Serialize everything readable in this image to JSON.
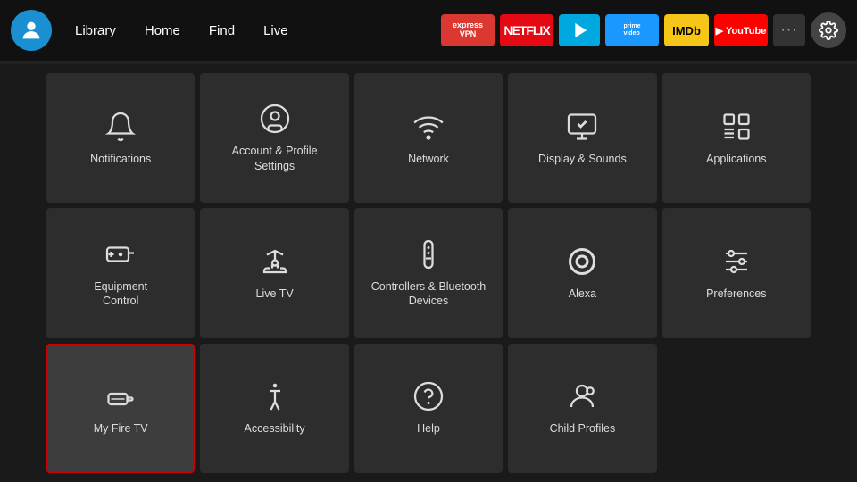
{
  "nav": {
    "links": [
      "Library",
      "Home",
      "Find",
      "Live"
    ],
    "apps": [
      {
        "name": "ExpressVPN",
        "label": "ExpressVPN"
      },
      {
        "name": "Netflix",
        "label": "NETFLIX"
      },
      {
        "name": "Freevee",
        "label": "▶"
      },
      {
        "name": "Prime Video",
        "label": "prime\nvideo"
      },
      {
        "name": "IMDb TV",
        "label": "IMDb"
      },
      {
        "name": "YouTube",
        "label": "▶ YouTube"
      }
    ]
  },
  "grid": {
    "items": [
      {
        "id": "notifications",
        "label": "Notifications",
        "icon": "bell"
      },
      {
        "id": "account-profile",
        "label": "Account & Profile\nSettings",
        "icon": "person-circle"
      },
      {
        "id": "network",
        "label": "Network",
        "icon": "wifi"
      },
      {
        "id": "display-sounds",
        "label": "Display & Sounds",
        "icon": "display-sound"
      },
      {
        "id": "applications",
        "label": "Applications",
        "icon": "apps"
      },
      {
        "id": "equipment-control",
        "label": "Equipment\nControl",
        "icon": "tv-remote"
      },
      {
        "id": "live-tv",
        "label": "Live TV",
        "icon": "antenna"
      },
      {
        "id": "controllers-bluetooth",
        "label": "Controllers & Bluetooth\nDevices",
        "icon": "remote"
      },
      {
        "id": "alexa",
        "label": "Alexa",
        "icon": "alexa"
      },
      {
        "id": "preferences",
        "label": "Preferences",
        "icon": "sliders"
      },
      {
        "id": "my-fire-tv",
        "label": "My Fire TV",
        "icon": "fire-stick",
        "selected": true
      },
      {
        "id": "accessibility",
        "label": "Accessibility",
        "icon": "accessibility"
      },
      {
        "id": "help",
        "label": "Help",
        "icon": "help"
      },
      {
        "id": "child-profiles",
        "label": "Child Profiles",
        "icon": "child-profile"
      }
    ]
  }
}
